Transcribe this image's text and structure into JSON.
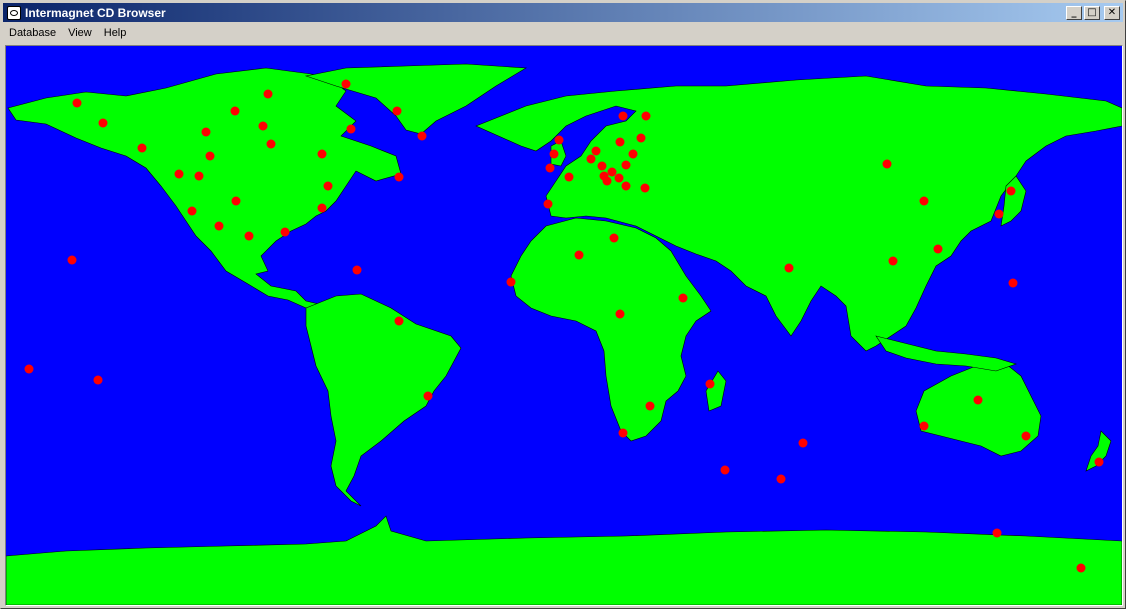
{
  "window": {
    "title": "Intermagnet CD Browser",
    "controls": {
      "minimize": "_",
      "maximize": "□",
      "close": "✕"
    }
  },
  "menu": {
    "items": [
      {
        "label": "Database"
      },
      {
        "label": "View"
      },
      {
        "label": "Help"
      }
    ]
  },
  "map": {
    "ocean_color": "#0000ff",
    "land_color": "#00ff00",
    "border_color": "#000000",
    "marker_color": "#ff0000",
    "observatory_count": 98
  },
  "icons": [
    "app-icon",
    "minimize-icon",
    "maximize-icon",
    "close-icon"
  ]
}
